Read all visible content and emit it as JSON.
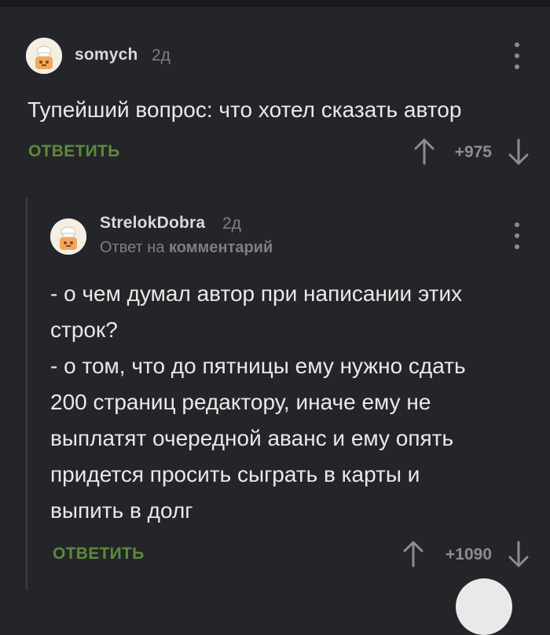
{
  "comments": [
    {
      "username": "somych",
      "time": "2д",
      "text_lines": [
        "Тупейший вопрос: что хотел сказать автор"
      ],
      "reply_label": "ОТВЕТИТЬ",
      "rating": "+975"
    },
    {
      "username": "StrelokDobra",
      "time": "2д",
      "reply_to_prefix": "Ответ на",
      "reply_to_target": "комментарий",
      "text_lines": [
        "- о чем думал автор при написании этих",
        "строк?",
        "- о том, что до пятницы ему нужно сдать",
        "200 страниц редактору, иначе ему не",
        "выплатят очередной аванс и ему опять",
        "придется просить сыграть в карты и",
        "выпить в долг"
      ],
      "reply_label": "ОТВЕТИТЬ",
      "rating": "+1090"
    }
  ],
  "icons": {
    "avatar": "default-avatar-icon",
    "menu": "kebab-menu-icon",
    "upvote": "arrow-up-icon",
    "downvote": "arrow-down-icon"
  },
  "colors": {
    "background": "#242528",
    "reply_accent": "#5d8a3c",
    "muted": "#7d7f84"
  }
}
